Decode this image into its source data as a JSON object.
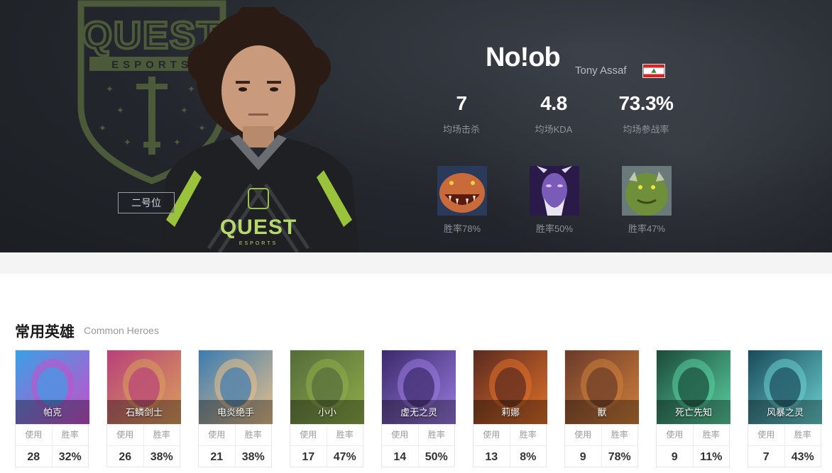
{
  "player": {
    "name": "No!ob",
    "real_name": "Tony Assaf",
    "flag_icon": "lebanon-flag-icon",
    "position": "二号位",
    "team_logo_text": "QUEST",
    "team_logo_subtext": "ESPORTS"
  },
  "stats": [
    {
      "value": "7",
      "label": "均场击杀"
    },
    {
      "value": "4.8",
      "label": "均场KDA"
    },
    {
      "value": "73.3%",
      "label": "均场参战率"
    }
  ],
  "top_heroes": [
    {
      "rate": "胜率78%",
      "color": "#c86a3a"
    },
    {
      "rate": "胜率50%",
      "color": "#7a5bb8"
    },
    {
      "rate": "胜率47%",
      "color": "#6f8f3a"
    }
  ],
  "section": {
    "title": "常用英雄",
    "subtitle": "Common Heroes",
    "use_label": "使用",
    "win_label": "胜率"
  },
  "heroes": [
    {
      "name": "帕克",
      "uses": "28",
      "winrate": "32%",
      "c1": "#3aa0e6",
      "c2": "#c84fc8"
    },
    {
      "name": "石鳞剑士",
      "uses": "26",
      "winrate": "38%",
      "c1": "#b8407a",
      "c2": "#d9a05a"
    },
    {
      "name": "电炎绝手",
      "uses": "21",
      "winrate": "38%",
      "c1": "#3b7bb0",
      "c2": "#e8c08a"
    },
    {
      "name": "小小",
      "uses": "17",
      "winrate": "47%",
      "c1": "#556b3a",
      "c2": "#8fae4a"
    },
    {
      "name": "虚无之灵",
      "uses": "14",
      "winrate": "50%",
      "c1": "#3a2a6a",
      "c2": "#9a7ae0"
    },
    {
      "name": "莉娜",
      "uses": "13",
      "winrate": "8%",
      "c1": "#5a2a20",
      "c2": "#e0702a"
    },
    {
      "name": "獸",
      "uses": "9",
      "winrate": "78%",
      "c1": "#6a3a2a",
      "c2": "#d0803a"
    },
    {
      "name": "死亡先知",
      "uses": "9",
      "winrate": "11%",
      "c1": "#1a4a3a",
      "c2": "#5ad0a0"
    },
    {
      "name": "风暴之灵",
      "uses": "7",
      "winrate": "43%",
      "c1": "#1a4a5a",
      "c2": "#6ad0d0"
    }
  ]
}
